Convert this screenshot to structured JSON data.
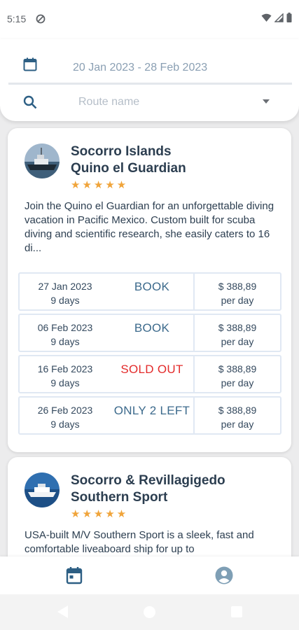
{
  "status_bar": {
    "time": "5:15",
    "icons": [
      "dnd-icon",
      "wifi-icon",
      "signal-icon",
      "battery-icon"
    ]
  },
  "search": {
    "date_range": "20 Jan 2023 - 28 Feb 2023",
    "route_placeholder": "Route name",
    "route_value": ""
  },
  "trips": [
    {
      "title_line1": "Socorro Islands",
      "title_line2": "Quino el Guardian",
      "rating": 5,
      "stars_text": "★★★★★",
      "description": "Join the Quino el Guardian for an unforgettable diving vacation in Pacific Mexico. Custom built for scuba diving and scientific research, she easily caters to 16 di...",
      "departures": [
        {
          "date": "27 Jan 2023",
          "duration": "9 days",
          "status": "BOOK",
          "price": "$ 388,89",
          "price_unit": "per day"
        },
        {
          "date": "06 Feb 2023",
          "duration": "9 days",
          "status": "BOOK",
          "price": "$ 388,89",
          "price_unit": "per day"
        },
        {
          "date": "16 Feb 2023",
          "duration": "9 days",
          "status": "SOLD OUT",
          "price": "$ 388,89",
          "price_unit": "per day"
        },
        {
          "date": "26 Feb 2023",
          "duration": "9 days",
          "status": "ONLY 2 LEFT",
          "price": "$ 388,89",
          "price_unit": "per day"
        }
      ]
    },
    {
      "title_line1": "Socorro & Revillagigedo",
      "title_line2": "Southern Sport",
      "rating": 5,
      "stars_text": "★★★★★",
      "description": "USA-built M/V Southern Sport is a sleek, fast and comfortable liveaboard ship for up to"
    }
  ],
  "colors": {
    "primary_text": "#2c3e50",
    "accent_blue": "#3c6a8c",
    "star_orange": "#f0a43a",
    "sold_out_red": "#e32b2b"
  },
  "bottom_nav": {
    "items": [
      "calendar-icon",
      "account-icon"
    ],
    "active": "calendar-icon"
  }
}
